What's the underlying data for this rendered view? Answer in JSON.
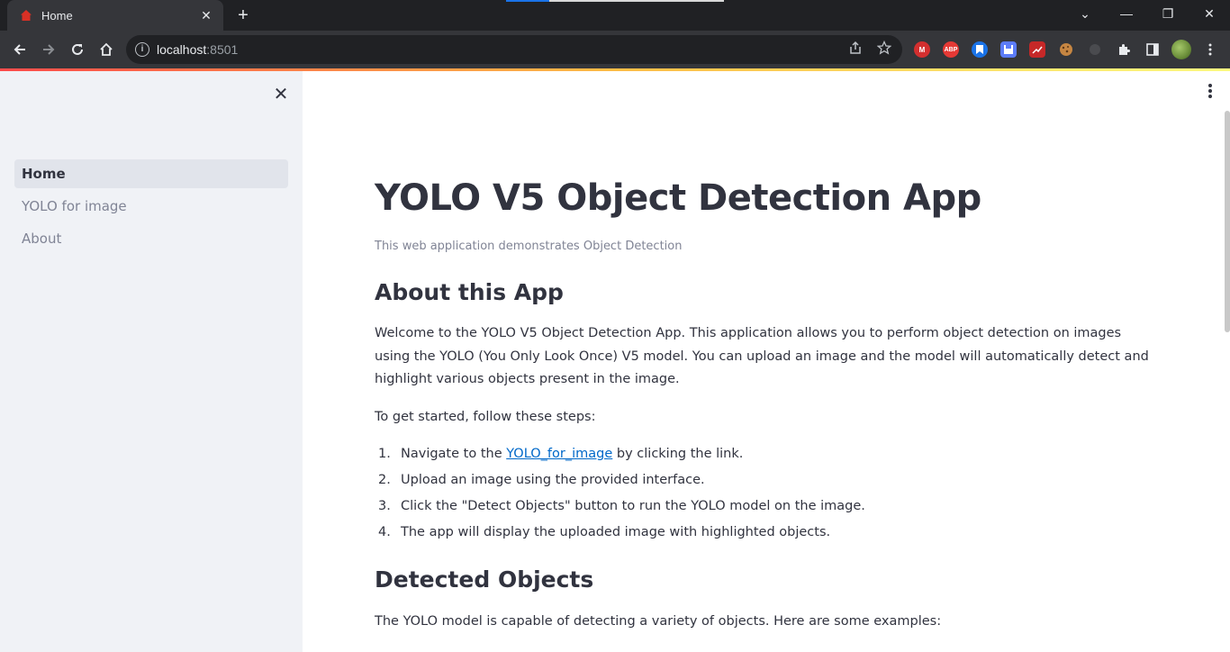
{
  "browser": {
    "tab_title": "Home",
    "tab_close": "✕",
    "new_tab": "+",
    "url_host": "localhost",
    "url_port": ":8501",
    "window_controls": [
      "⌄",
      "—",
      "❐",
      "✕"
    ]
  },
  "extensions": [
    "M",
    "ABP",
    "",
    "",
    "",
    "",
    "",
    "",
    "",
    ""
  ],
  "sidebar": {
    "close": "✕",
    "items": [
      {
        "label": "Home",
        "active": true
      },
      {
        "label": "YOLO for image",
        "active": false
      },
      {
        "label": "About",
        "active": false
      }
    ]
  },
  "main": {
    "title": "YOLO V5 Object Detection App",
    "caption": "This web application demonstrates Object Detection",
    "about_heading": "About this App",
    "about_text": "Welcome to the YOLO V5 Object Detection App. This application allows you to perform object detection on images using the YOLO (You Only Look Once) V5 model. You can upload an image and the model will automatically detect and highlight various objects present in the image.",
    "steps_intro": "To get started, follow these steps:",
    "steps": [
      {
        "num": "1.",
        "pre": "Navigate to the ",
        "link": "YOLO_for_image",
        "post": " by clicking the link."
      },
      {
        "num": "2.",
        "text": "Upload an image using the provided interface."
      },
      {
        "num": "3.",
        "text": "Click the \"Detect Objects\" button to run the YOLO model on the image."
      },
      {
        "num": "4.",
        "text": "The app will display the uploaded image with highlighted objects."
      }
    ],
    "detected_heading": "Detected Objects",
    "detected_text": "The YOLO model is capable of detecting a variety of objects. Here are some examples:"
  }
}
